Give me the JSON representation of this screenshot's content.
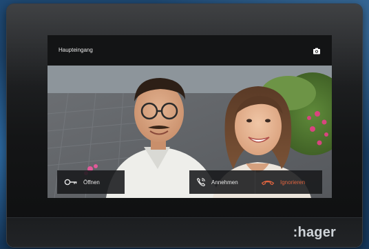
{
  "screen": {
    "title": "Haupteingang",
    "camera_icon": "camera-icon"
  },
  "actions": {
    "open": {
      "label": "Öffnen",
      "icon": "key-icon"
    },
    "answer": {
      "label": "Annehmen",
      "icon": "phone-answer-icon"
    },
    "ignore": {
      "label": "Ignorieren",
      "icon": "phone-hangup-icon",
      "color": "#e0643f"
    }
  },
  "brand": {
    "logo": ":hager"
  }
}
